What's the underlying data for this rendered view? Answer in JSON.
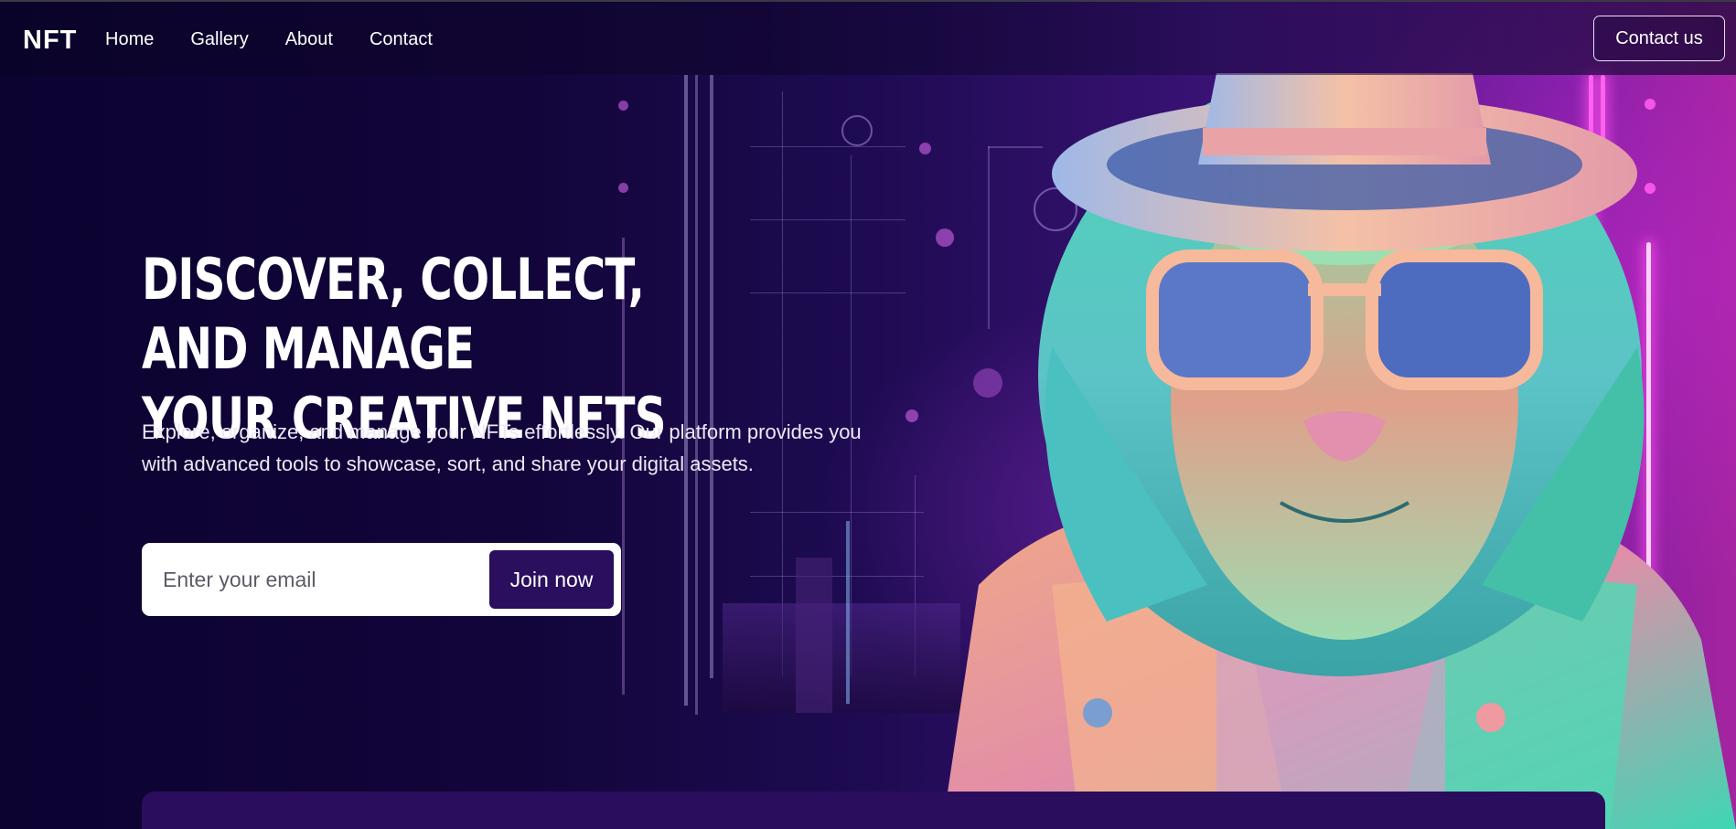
{
  "nav": {
    "logo": "NFT",
    "links": [
      "Home",
      "Gallery",
      "About",
      "Contact"
    ],
    "cta_label": "Contact us"
  },
  "hero": {
    "title": "DISCOVER, COLLECT, AND MANAGE\nYOUR CREATIVE NFTS",
    "subtitle": "Explore, organize, and manage your NFTs effortlessly. Our platform provides you with advanced tools to showcase, sort, and share your digital assets.",
    "email_placeholder": "Enter your email",
    "join_label": "Join now"
  },
  "colors": {
    "background": "#0d0430",
    "join_button": "#2a0f5e",
    "neon_pink": "#ff4fe8"
  },
  "artwork": "lion-with-hat-and-glasses-illustration"
}
